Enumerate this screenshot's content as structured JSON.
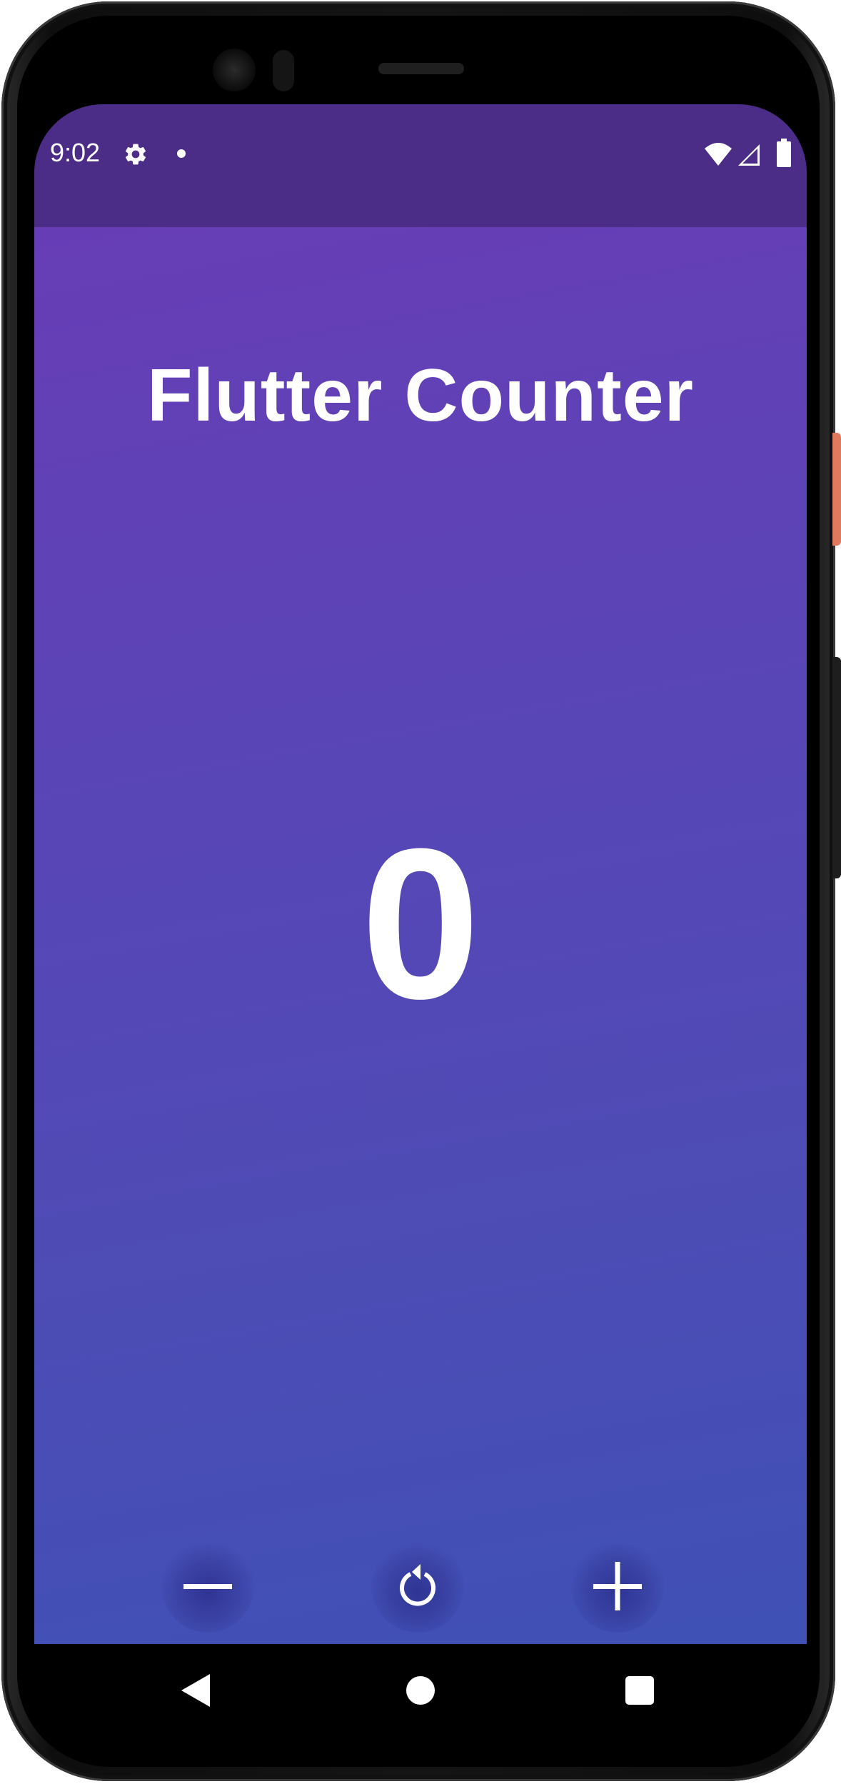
{
  "status_bar": {
    "time": "9:02",
    "icons": [
      "gear-icon",
      "notification-dot-icon",
      "wifi-icon",
      "signal-icon",
      "battery-icon"
    ],
    "background": "#4b2c87"
  },
  "app": {
    "title": "Flutter Counter",
    "counter_value": "0",
    "gradient_start": "#673db6",
    "gradient_end": "#3f51b5",
    "controls": [
      {
        "name": "decrement",
        "icon": "minus-icon"
      },
      {
        "name": "reset",
        "icon": "refresh-icon"
      },
      {
        "name": "increment",
        "icon": "plus-icon"
      }
    ]
  },
  "nav_bar": {
    "buttons": [
      "back-triangle-icon",
      "home-circle-icon",
      "recents-square-icon"
    ]
  }
}
